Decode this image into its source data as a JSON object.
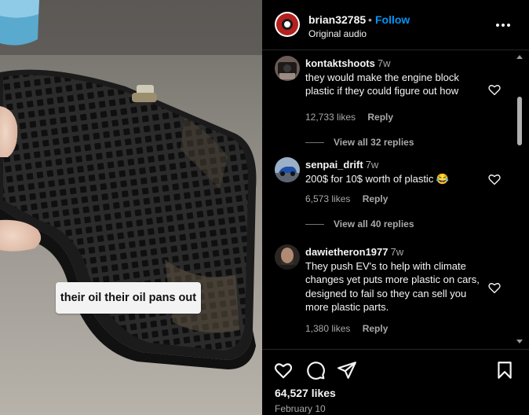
{
  "post": {
    "author": "brian32785",
    "separator": "•",
    "follow_label": "Follow",
    "audio_label": "Original audio",
    "more_icon": "more-horizontal-icon"
  },
  "media": {
    "caption_text": "their oil their oil pans out"
  },
  "comments": [
    {
      "username": "kontaktshoots",
      "time": "7w",
      "text": "they would make the engine block plastic if they could figure out how",
      "likes": "12,733 likes",
      "reply_label": "Reply",
      "view_replies": "View all 32 replies"
    },
    {
      "username": "senpai_drift",
      "time": "7w",
      "text": "200$ for 10$ worth of plastic 😂",
      "likes": "6,573 likes",
      "reply_label": "Reply",
      "view_replies": "View all 40 replies"
    },
    {
      "username": "dawietheron1977",
      "time": "7w",
      "text": "They push EV's to help with climate changes yet puts more plastic on cars, designed to fail so they can sell you more plastic parts.",
      "likes": "1,380 likes",
      "reply_label": "Reply"
    }
  ],
  "footer": {
    "like_count": "64,527 likes",
    "date": "February 10"
  },
  "colors": {
    "accent": "#0095f6",
    "background": "#000000",
    "muted_text": "#a8a8a8"
  }
}
